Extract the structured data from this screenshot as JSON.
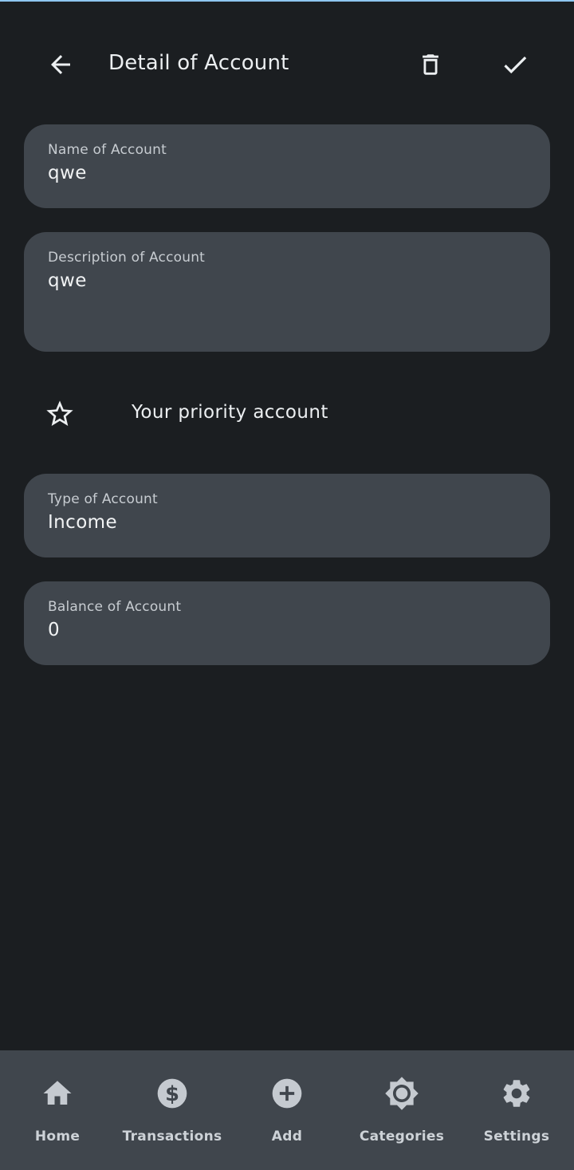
{
  "app_bar": {
    "title": "Detail of Account",
    "back_icon": "arrow-left-icon",
    "delete_icon": "trash-icon",
    "confirm_icon": "checkmark-icon"
  },
  "form": {
    "name": {
      "label": "Name of Account",
      "value": "qwe"
    },
    "description": {
      "label": "Description of Account",
      "value": "qwe"
    },
    "priority": {
      "label": "Your priority account",
      "icon": "star-outline-icon",
      "checked": false
    },
    "type": {
      "label": "Type of Account",
      "value": "Income"
    },
    "balance": {
      "label": "Balance of Account",
      "value": "0"
    }
  },
  "bottom_nav": {
    "items": [
      {
        "label": "Home",
        "icon": "home-icon"
      },
      {
        "label": "Transactions",
        "icon": "dollar-circle-icon"
      },
      {
        "label": "Add",
        "icon": "plus-circle-icon"
      },
      {
        "label": "Categories",
        "icon": "brightness-icon"
      },
      {
        "label": "Settings",
        "icon": "gear-icon"
      }
    ]
  },
  "colors": {
    "background": "#1b1e21",
    "surface": "#40464d",
    "text": "#eceff1",
    "label": "#c7ccd1",
    "nav_icon": "#c5cad0",
    "accent_line": "#8fc6f0"
  }
}
